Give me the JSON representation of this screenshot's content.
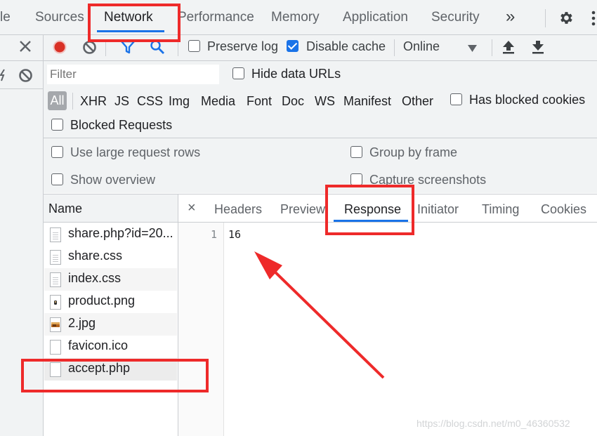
{
  "top_tabs": {
    "partial_left": "le",
    "sources": "Sources",
    "network": "Network",
    "performance": "Performance",
    "memory": "Memory",
    "application": "Application",
    "security": "Security",
    "more": "»"
  },
  "toolbar": {
    "preserve_log": "Preserve log",
    "preserve_log_checked": false,
    "disable_cache": "Disable cache",
    "disable_cache_checked": true,
    "throttling": "Online"
  },
  "filter": {
    "placeholder": "Filter",
    "hide_data_urls": "Hide data URLs",
    "types": [
      "All",
      "XHR",
      "JS",
      "CSS",
      "Img",
      "Media",
      "Font",
      "Doc",
      "WS",
      "Manifest",
      "Other"
    ],
    "has_blocked_cookies": "Has blocked cookies",
    "blocked_requests": "Blocked Requests"
  },
  "settings": {
    "large_rows": "Use large request rows",
    "group_by_frame": "Group by frame",
    "show_overview": "Show overview",
    "capture_screenshots": "Capture screenshots"
  },
  "requests": {
    "header": "Name",
    "rows": [
      {
        "name": "share.php?id=20...",
        "icon": "document-icon"
      },
      {
        "name": "share.css",
        "icon": "document-icon"
      },
      {
        "name": "index.css",
        "icon": "document-icon"
      },
      {
        "name": "product.png",
        "icon": "image-icon"
      },
      {
        "name": "2.jpg",
        "icon": "image-icon"
      },
      {
        "name": "favicon.ico",
        "icon": "blank-file-icon"
      },
      {
        "name": "accept.php",
        "icon": "blank-file-icon"
      }
    ]
  },
  "detail": {
    "close": "×",
    "tabs": [
      "Headers",
      "Preview",
      "Response",
      "Initiator",
      "Timing",
      "Cookies"
    ],
    "active_tab": "Response",
    "line_number": "1",
    "response_body": "16"
  },
  "watermark": "https://blog.csdn.net/m0_46360532",
  "colors": {
    "accent": "#1a73e8",
    "record": "#d93025",
    "annotation": "#ee2a2a"
  }
}
